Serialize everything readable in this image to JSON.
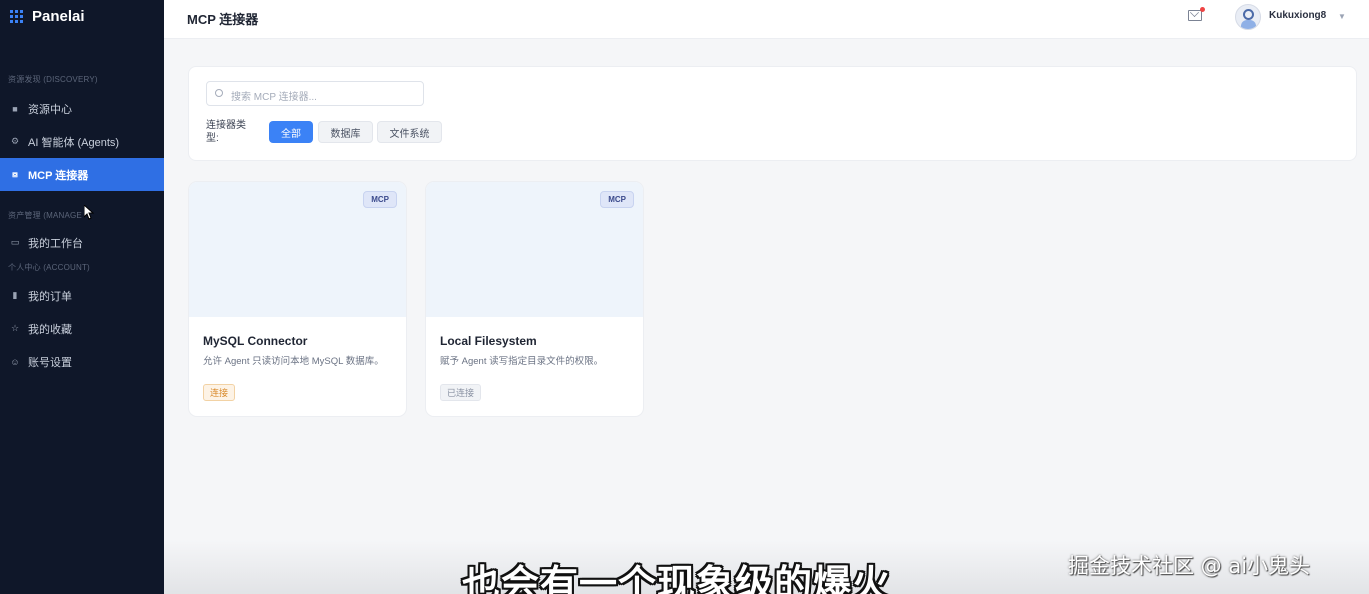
{
  "app": {
    "brand": "Panelai"
  },
  "sidebar": {
    "sections": [
      {
        "label": "资源发现 (DISCOVERY)",
        "items": [
          {
            "label": "资源中心",
            "icon": "database-icon"
          },
          {
            "label": "AI 智能体 (Agents)",
            "icon": "gear-icon"
          },
          {
            "label": "MCP 连接器",
            "icon": "connector-icon",
            "active": true
          }
        ]
      },
      {
        "label": "资产管理 (MANAGE",
        "items": [
          {
            "label": "我的工作台",
            "icon": "monitor-icon"
          }
        ]
      },
      {
        "label": "个人中心 (ACCOUNT)",
        "items": [
          {
            "label": "我的订单",
            "icon": "clipboard-icon"
          },
          {
            "label": "我的收藏",
            "icon": "star-icon"
          },
          {
            "label": "账号设置",
            "icon": "user-icon"
          }
        ]
      }
    ]
  },
  "header": {
    "title": "MCP 连接器",
    "username": "Kukuxiong8"
  },
  "filters": {
    "search_placeholder": "搜索 MCP 连接器...",
    "type_label": "连接器类型:",
    "chips": [
      "全部",
      "数据库",
      "文件系统"
    ],
    "active_chip": "全部"
  },
  "connectors": [
    {
      "badge": "MCP",
      "title": "MySQL Connector",
      "description": "允许 Agent 只读访问本地 MySQL 数据库。",
      "status": "连接"
    },
    {
      "badge": "MCP",
      "title": "Local Filesystem",
      "description": "赋予 Agent 读写指定目录文件的权限。",
      "status": "已连接"
    }
  ],
  "overlay": {
    "subtitle": "也会有一个现象级的爆火",
    "watermark": "掘金技术社区 @ ai小鬼头"
  },
  "colors": {
    "sidebar_bg": "#0f1729",
    "accent": "#3b82f6",
    "active_nav": "#2f6fe4"
  }
}
